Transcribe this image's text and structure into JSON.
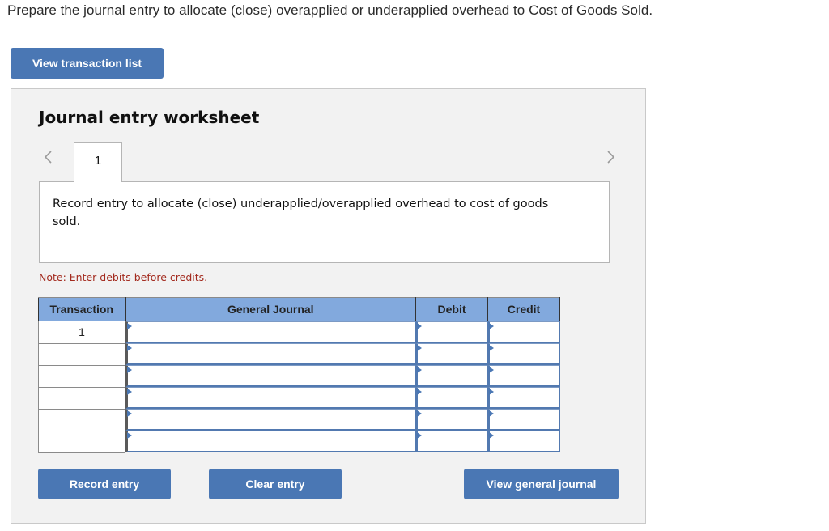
{
  "prompt": "Prepare the journal entry to allocate (close) overapplied or underapplied overhead to Cost of Goods Sold.",
  "buttons": {
    "view_transaction_list": "View transaction list",
    "record_entry": "Record entry",
    "clear_entry": "Clear entry",
    "view_general_journal": "View general journal"
  },
  "worksheet": {
    "title": "Journal entry worksheet",
    "nav": {
      "prev_icon": "chevron-left-icon",
      "next_icon": "chevron-right-icon"
    },
    "tabs": [
      {
        "label": "1",
        "active": true
      }
    ],
    "description": "Record entry to allocate (close) underapplied/overapplied overhead to cost of goods sold.",
    "note": "Note: Enter debits before credits."
  },
  "table": {
    "columns": [
      "Transaction",
      "General Journal",
      "Debit",
      "Credit"
    ],
    "rows": [
      {
        "transaction": "1",
        "account": "",
        "debit": "",
        "credit": ""
      },
      {
        "transaction": "",
        "account": "",
        "debit": "",
        "credit": ""
      },
      {
        "transaction": "",
        "account": "",
        "debit": "",
        "credit": ""
      },
      {
        "transaction": "",
        "account": "",
        "debit": "",
        "credit": ""
      },
      {
        "transaction": "",
        "account": "",
        "debit": "",
        "credit": ""
      },
      {
        "transaction": "",
        "account": "",
        "debit": "",
        "credit": ""
      }
    ]
  },
  "colors": {
    "button_bg": "#4a77b4",
    "header_bg": "#82a9dd",
    "note_text": "#a32a1e",
    "panel_bg": "#f2f2f2"
  }
}
